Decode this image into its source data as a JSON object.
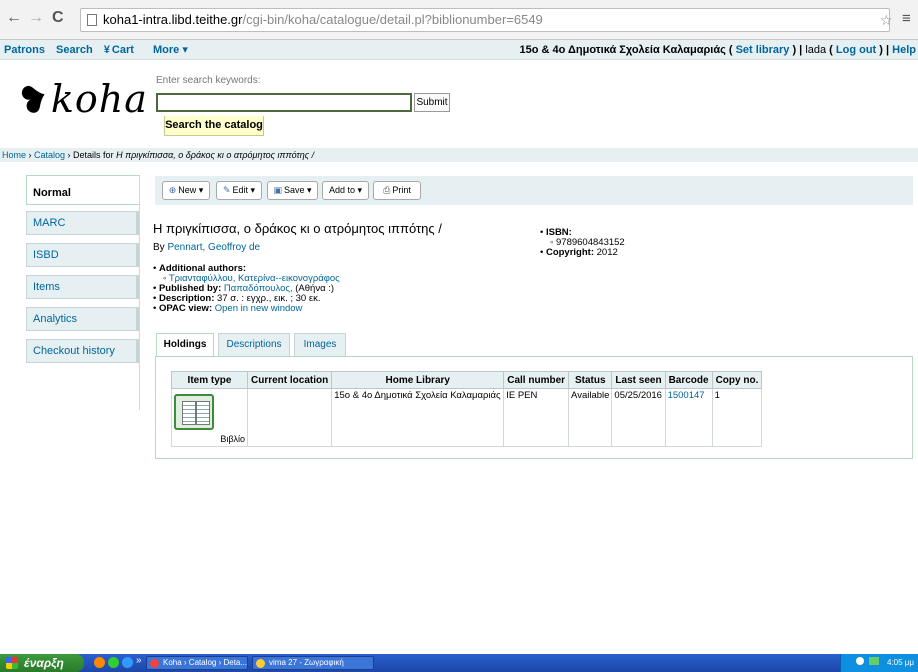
{
  "browser": {
    "back": "←",
    "forward": "→",
    "reload": "C",
    "url_host": "koha1-intra.libd.teithe.gr",
    "url_path": "/cgi-bin/koha/catalogue/detail.pl?biblionumber=6549",
    "star": "☆",
    "menu": "≡"
  },
  "topbar": {
    "patrons": "Patrons",
    "search": "Search",
    "cart": "Cart",
    "more": "More ▾",
    "branch": "15ο & 4ο Δημοτικά Σχολεία Καλαμαριάς",
    "set_library": "Set library",
    "user": "lada",
    "log_out": "Log out",
    "help": "Help"
  },
  "header": {
    "logo": "koha",
    "search_label": "Enter search keywords:",
    "search_value": "",
    "submit": "Submit",
    "search_tab": "Search the catalog"
  },
  "breadcrumbs": {
    "home": "Home",
    "catalog": "Catalog",
    "details_prefix": "Details for",
    "current": "Η πριγκίπισσα, ο δράκος κι ο ατρόμητος ιππότης /"
  },
  "leftmenu": [
    "Normal",
    "MARC",
    "ISBD",
    "Items",
    "Analytics",
    "Checkout history"
  ],
  "toolbar": {
    "new": "New ▾",
    "edit": "Edit ▾",
    "save": "Save ▾",
    "add_to": "Add to ▾",
    "print": "Print"
  },
  "record": {
    "title": "Η πριγκίπισσα, ο δράκος κι ο ατρόμητος ιππότης /",
    "by": "By",
    "author": "Pennart, Geoffroy de",
    "additional_authors_label": "Additional authors:",
    "additional_author": "Τριανταφύλλου, Κατερίνα--εικονογράφος",
    "published_label": "Published by:",
    "publisher": "Παπαδόπουλος,",
    "place": "(Αθήνα :)",
    "description_label": "Description:",
    "description": "37 σ. : εγχρ., εικ. ; 30 εκ.",
    "opac_label": "OPAC view:",
    "opac_link": "Open in new window",
    "isbn_label": "ISBN:",
    "isbn": "9789604843152",
    "copyright_label": "Copyright:",
    "copyright": "2012"
  },
  "tabs": [
    "Holdings",
    "Descriptions",
    "Images"
  ],
  "holdings": {
    "headers": [
      "Item type",
      "Current location",
      "Home Library",
      "Call number",
      "Status",
      "Last seen",
      "Barcode",
      "Copy no."
    ],
    "rows": [
      {
        "item_type": "Βιβλίο",
        "current_location": "",
        "home_library": "15ο & 4ο Δημοτικά Σχολεία Καλαμαριάς",
        "call_number": "ΙΕ ΡΕΝ",
        "status": "Available",
        "last_seen": "05/25/2016",
        "barcode": "1500147",
        "copy_no": "1"
      }
    ]
  },
  "taskbar": {
    "start": "έναρξη",
    "more": "»",
    "task1": "Koha › Catalog › Deta...",
    "task2": "vima 27 - Ζωγραφική",
    "clock": "4:05 μμ"
  },
  "colors": {
    "link": "#006699",
    "header_bg": "#e6f0f2",
    "search_tab_bg": "#ffffcc",
    "taskbar": "#2a5fcf",
    "start_button": "#3c9a3c"
  }
}
